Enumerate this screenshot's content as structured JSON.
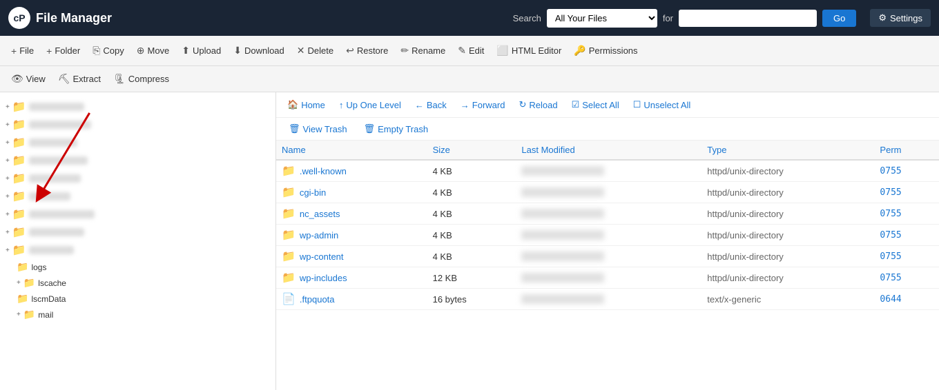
{
  "header": {
    "logo_text": "cP",
    "title": "File Manager",
    "search_label": "Search",
    "search_select_value": "All Your Files",
    "search_for_label": "for",
    "search_input_placeholder": "",
    "search_go_label": "Go",
    "settings_label": "Settings"
  },
  "toolbar": {
    "buttons": [
      {
        "id": "file",
        "icon": "+",
        "label": "File"
      },
      {
        "id": "folder",
        "icon": "+",
        "label": "Folder"
      },
      {
        "id": "copy",
        "icon": "⎘",
        "label": "Copy"
      },
      {
        "id": "move",
        "icon": "⊕",
        "label": "Move"
      },
      {
        "id": "upload",
        "icon": "⬆",
        "label": "Upload"
      },
      {
        "id": "download",
        "icon": "⬇",
        "label": "Download"
      },
      {
        "id": "delete",
        "icon": "✕",
        "label": "Delete"
      },
      {
        "id": "restore",
        "icon": "↩",
        "label": "Restore"
      },
      {
        "id": "rename",
        "icon": "✏",
        "label": "Rename"
      },
      {
        "id": "edit",
        "icon": "✎",
        "label": "Edit"
      },
      {
        "id": "html-editor",
        "icon": "⬜",
        "label": "HTML Editor"
      },
      {
        "id": "permissions",
        "icon": "🔑",
        "label": "Permissions"
      }
    ],
    "row2": [
      {
        "id": "view",
        "icon": "👁",
        "label": "View"
      },
      {
        "id": "extract",
        "icon": "⛏",
        "label": "Extract"
      },
      {
        "id": "compress",
        "icon": "🗜",
        "label": "Compress"
      }
    ]
  },
  "nav": {
    "home_label": "Home",
    "up_one_level_label": "Up One Level",
    "back_label": "Back",
    "forward_label": "Forward",
    "reload_label": "Reload",
    "select_all_label": "Select All",
    "unselect_all_label": "Unselect All",
    "view_trash_label": "View Trash",
    "empty_trash_label": "Empty Trash"
  },
  "table": {
    "headers": [
      "Name",
      "Size",
      "Last Modified",
      "Type",
      "Perm"
    ],
    "rows": [
      {
        "name": ".well-known",
        "size": "4 KB",
        "last_modified": "REDACTED",
        "type": "httpd/unix-directory",
        "perm": "0755",
        "is_folder": true
      },
      {
        "name": "cgi-bin",
        "size": "4 KB",
        "last_modified": "REDACTED",
        "type": "httpd/unix-directory",
        "perm": "0755",
        "is_folder": true
      },
      {
        "name": "nc_assets",
        "size": "4 KB",
        "last_modified": "REDACTED",
        "type": "httpd/unix-directory",
        "perm": "0755",
        "is_folder": true
      },
      {
        "name": "wp-admin",
        "size": "4 KB",
        "last_modified": "REDACTED",
        "type": "httpd/unix-directory",
        "perm": "0755",
        "is_folder": true
      },
      {
        "name": "wp-content",
        "size": "4 KB",
        "last_modified": "REDACTED",
        "type": "httpd/unix-directory",
        "perm": "0755",
        "is_folder": true
      },
      {
        "name": "wp-includes",
        "size": "12 KB",
        "last_modified": "REDACTED",
        "type": "httpd/unix-directory",
        "perm": "0755",
        "is_folder": true
      },
      {
        "name": ".ftpquota",
        "size": "16 bytes",
        "last_modified": "REDACTED",
        "type": "text/x-generic",
        "perm": "0644",
        "is_folder": false
      }
    ]
  },
  "sidebar": {
    "items": [
      {
        "label": "",
        "indent": 0,
        "has_expand": true
      },
      {
        "label": "",
        "indent": 0,
        "has_expand": true
      },
      {
        "label": "",
        "indent": 0,
        "has_expand": true
      },
      {
        "label": "",
        "indent": 0,
        "has_expand": true
      },
      {
        "label": "",
        "indent": 0,
        "has_expand": true
      },
      {
        "label": "",
        "indent": 0,
        "has_expand": true
      },
      {
        "label": "",
        "indent": 0,
        "has_expand": true
      },
      {
        "label": "",
        "indent": 0,
        "has_expand": true
      },
      {
        "label": "",
        "indent": 0,
        "has_expand": true
      },
      {
        "label": "logs",
        "indent": 1,
        "has_expand": false
      },
      {
        "label": "lscache",
        "indent": 1,
        "has_expand": true
      },
      {
        "label": "lscmData",
        "indent": 1,
        "has_expand": false
      },
      {
        "label": "mail",
        "indent": 1,
        "has_expand": true
      }
    ]
  },
  "colors": {
    "header_bg": "#1a2535",
    "toolbar_bg": "#f5f5f5",
    "accent": "#1976d2",
    "folder_color": "#e8a000",
    "arrow_red": "#cc0000"
  }
}
